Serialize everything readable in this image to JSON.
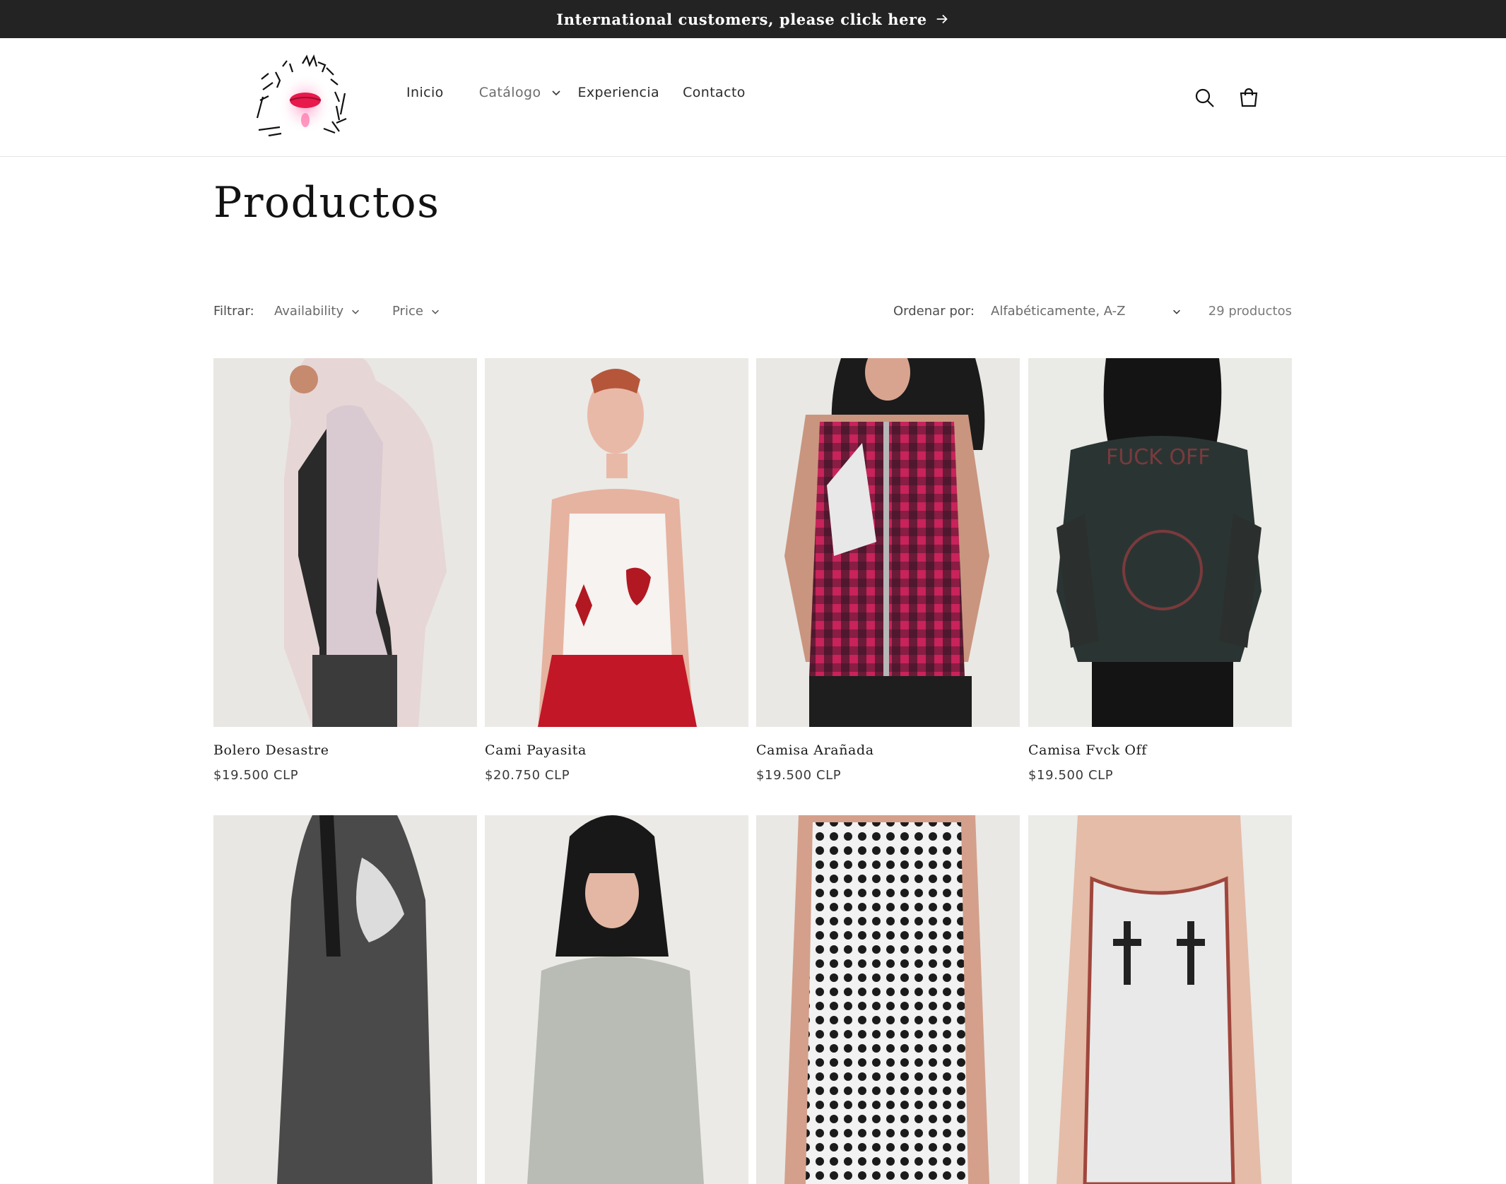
{
  "announcement": {
    "text": "International customers, please click here"
  },
  "header": {
    "logo_alt": "LABIOS ENVENENADOS",
    "nav": [
      {
        "label": "Inicio"
      },
      {
        "label": "Catálogo"
      },
      {
        "label": "Experiencia"
      },
      {
        "label": "Contacto"
      }
    ],
    "icons": [
      "search-icon",
      "cart-icon"
    ]
  },
  "page": {
    "title": "Productos"
  },
  "filters": {
    "filter_label": "Filtrar:",
    "availability": "Availability",
    "price": "Price",
    "sort_label": "Ordenar por:",
    "sort_value": "Alfabéticamente, A-Z",
    "count": "29 productos"
  },
  "products": [
    {
      "name": "Bolero Desastre",
      "price": "$19.500 CLP"
    },
    {
      "name": "Cami Payasita",
      "price": "$20.750 CLP"
    },
    {
      "name": "Camisa Arañada",
      "price": "$19.500 CLP"
    },
    {
      "name": "Camisa Fvck Off",
      "price": "$19.500 CLP"
    },
    {
      "name": "",
      "price": ""
    },
    {
      "name": "",
      "price": ""
    },
    {
      "name": "",
      "price": ""
    },
    {
      "name": "",
      "price": ""
    }
  ],
  "colors": {
    "announcement_bg": "#232323",
    "text": "#121212",
    "accent_logo": "#e8194b"
  }
}
